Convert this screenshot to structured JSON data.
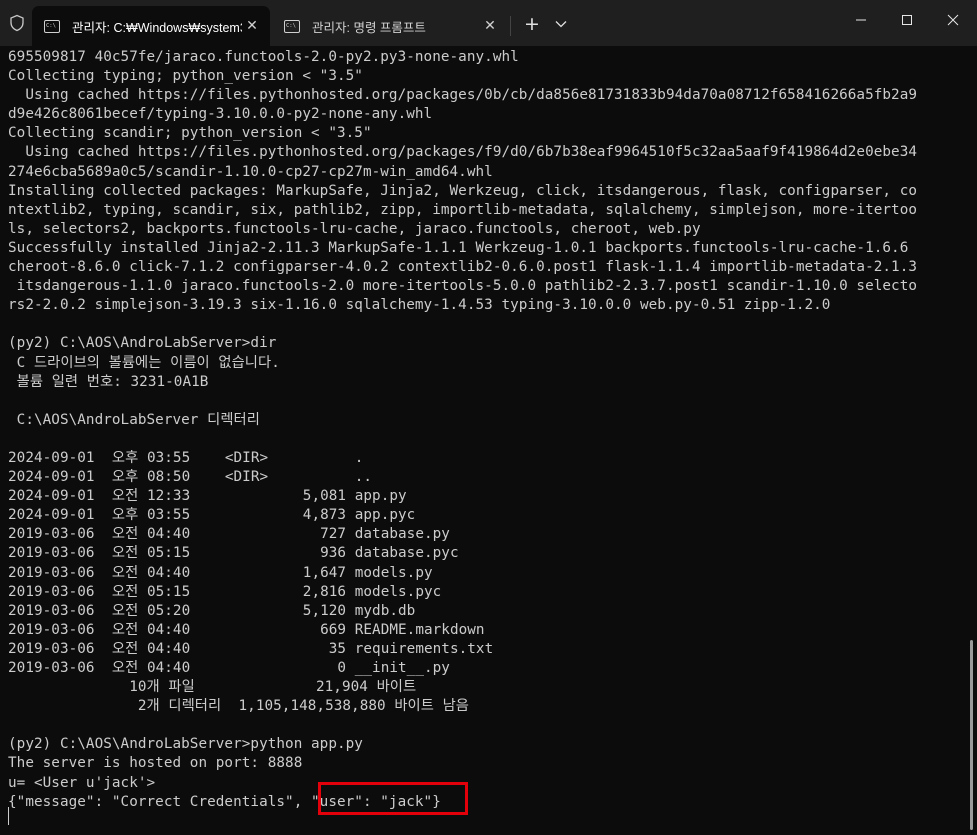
{
  "window": {
    "tabs": [
      {
        "title": "관리자: C:₩Windows₩system3",
        "active": true
      },
      {
        "title": "관리자: 명령 프롬프트",
        "active": false
      }
    ],
    "new_tab": "+",
    "dropdown": "⌄"
  },
  "colors": {
    "background": "#0c0c0c",
    "titlebar": "#1f1f1f",
    "text": "#cccccc",
    "highlight": "#e3000b"
  },
  "terminal": {
    "lines": [
      "695509817 40c57fe/jaraco.functools-2.0-py2.py3-none-any.whl",
      "Collecting typing; python_version < \"3.5\"",
      "  Using cached https://files.pythonhosted.org/packages/0b/cb/da856e81731833b94da70a08712f658416266a5fb2a9",
      "d9e426c8061becef/typing-3.10.0.0-py2-none-any.whl",
      "Collecting scandir; python_version < \"3.5\"",
      "  Using cached https://files.pythonhosted.org/packages/f9/d0/6b7b38eaf9964510f5c32aa5aaf9f419864d2e0ebe34",
      "274e6cba5689a0c5/scandir-1.10.0-cp27-cp27m-win_amd64.whl",
      "Installing collected packages: MarkupSafe, Jinja2, Werkzeug, click, itsdangerous, flask, configparser, co",
      "ntextlib2, typing, scandir, six, pathlib2, zipp, importlib-metadata, sqlalchemy, simplejson, more-itertoo",
      "ls, selectors2, backports.functools-lru-cache, jaraco.functools, cheroot, web.py",
      "Successfully installed Jinja2-2.11.3 MarkupSafe-1.1.1 Werkzeug-1.0.1 backports.functools-lru-cache-1.6.6",
      "cheroot-8.6.0 click-7.1.2 configparser-4.0.2 contextlib2-0.6.0.post1 flask-1.1.4 importlib-metadata-2.1.3",
      " itsdangerous-1.1.0 jaraco.functools-2.0 more-itertools-5.0.0 pathlib2-2.3.7.post1 scandir-1.10.0 selecto",
      "rs2-2.0.2 simplejson-3.19.3 six-1.16.0 sqlalchemy-1.4.53 typing-3.10.0.0 web.py-0.51 zipp-1.2.0",
      "",
      "(py2) C:\\AOS\\AndroLabServer>dir",
      " C 드라이브의 볼륨에는 이름이 없습니다.",
      " 볼륨 일련 번호: 3231-0A1B",
      "",
      " C:\\AOS\\AndroLabServer 디렉터리",
      "",
      "2024-09-01  오후 03:55    <DIR>          .",
      "2024-09-01  오후 08:50    <DIR>          ..",
      "2024-09-01  오전 12:33             5,081 app.py",
      "2024-09-01  오후 03:55             4,873 app.pyc",
      "2019-03-06  오전 04:40               727 database.py",
      "2019-03-06  오전 05:15               936 database.pyc",
      "2019-03-06  오전 04:40             1,647 models.py",
      "2019-03-06  오전 05:15             2,816 models.pyc",
      "2019-03-06  오전 05:20             5,120 mydb.db",
      "2019-03-06  오전 04:40               669 README.markdown",
      "2019-03-06  오전 04:40                35 requirements.txt",
      "2019-03-06  오전 04:40                 0 __init__.py",
      "              10개 파일              21,904 바이트",
      "               2개 디렉터리  1,105,148,538,880 바이트 남음",
      "",
      "(py2) C:\\AOS\\AndroLabServer>python app.py",
      "The server is hosted on port: 8888",
      "u= <User u'jack'>",
      "{\"message\": \"Correct Credentials\", \"user\": \"jack\"}",
      ""
    ]
  }
}
